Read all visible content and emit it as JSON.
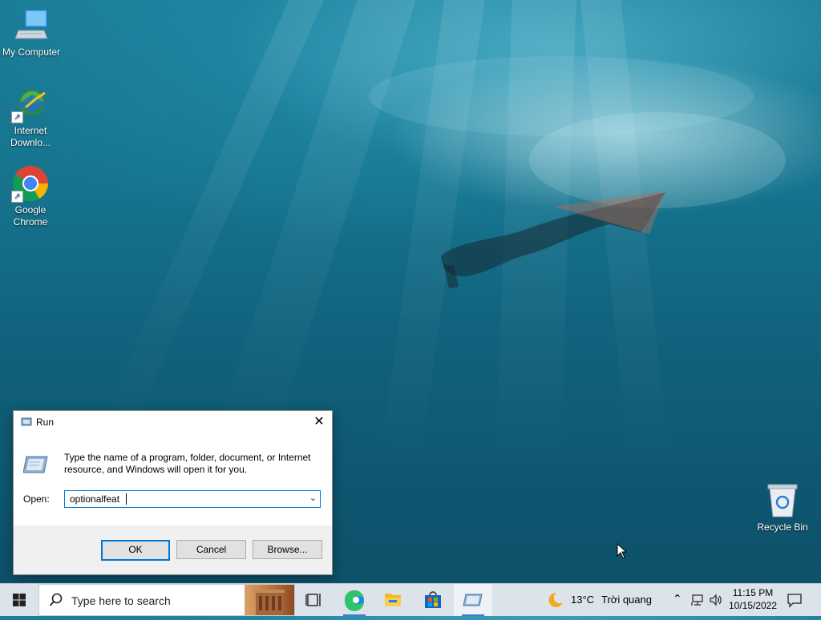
{
  "desktop": {
    "icons": [
      {
        "label": "My Computer",
        "icon": "computer-icon"
      },
      {
        "label": "Internet Downlo...",
        "icon": "internet-download-manager-icon"
      },
      {
        "label": "Google Chrome",
        "icon": "chrome-icon"
      },
      {
        "label": "Recycle Bin",
        "icon": "recycle-bin-icon"
      }
    ]
  },
  "run_dialog": {
    "title": "Run",
    "description": "Type the name of a program, folder, document, or Internet resource, and Windows will open it for you.",
    "open_label": "Open:",
    "open_value": "optionalfeat",
    "ok_label": "OK",
    "cancel_label": "Cancel",
    "browse_label": "Browse...",
    "accent": "#0078d7"
  },
  "taskbar": {
    "search_placeholder": "Type here to search",
    "apps": [
      "task-view-icon",
      "edge-icon",
      "file-explorer-icon",
      "microsoft-store-icon",
      "run-icon"
    ],
    "weather_temp": "13°C",
    "weather_text": "Trời quang",
    "time": "11:15 PM",
    "date": "10/15/2022"
  }
}
